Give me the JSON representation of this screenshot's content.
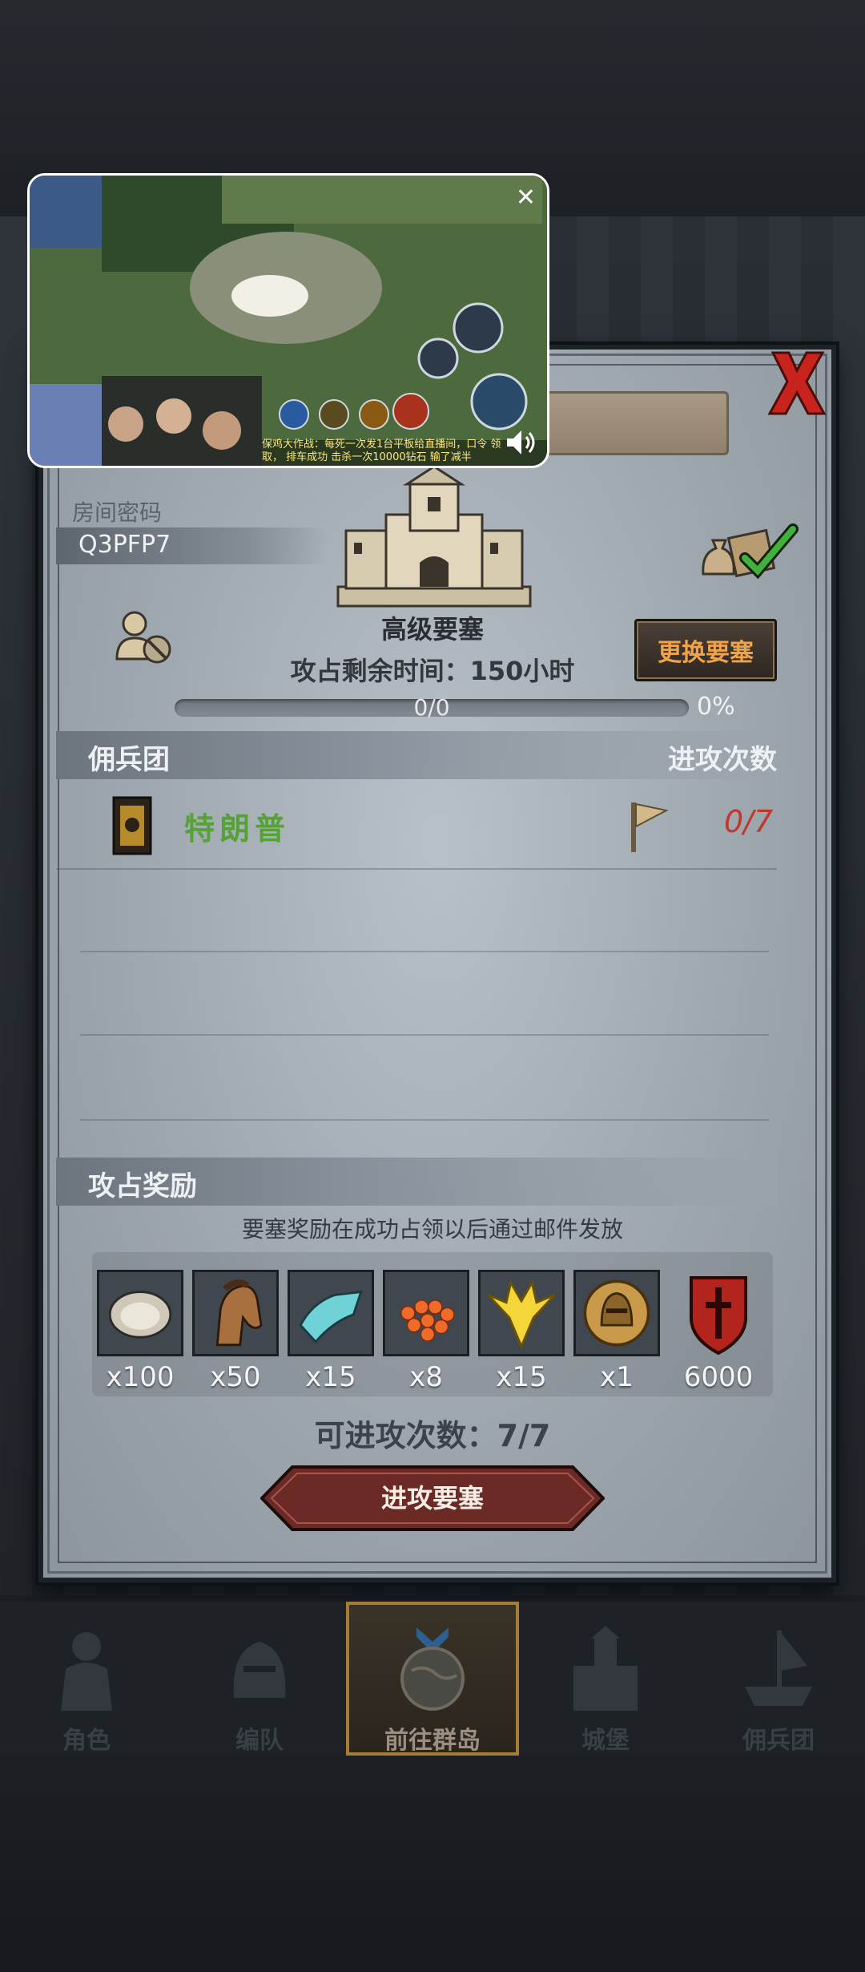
{
  "room": {
    "label": "房间密码",
    "code": "Q3PFP7"
  },
  "fortress": {
    "name": "高级要塞",
    "time_left": "攻占剩余时间：150小时",
    "change_button": "更换要塞"
  },
  "progress": {
    "text": "0/0",
    "percent_text": "0%",
    "fraction": 0
  },
  "mercenary_section": {
    "title": "佣兵团",
    "right_title": "进攻次数"
  },
  "mercenary": {
    "name": "特朗普",
    "attacks": "0/7"
  },
  "reward_section": {
    "title": "攻占奖励",
    "note": "要塞奖励在成功占领以后通过邮件发放"
  },
  "rewards": [
    {
      "icon": "oyster-icon",
      "qty": "x100"
    },
    {
      "icon": "horse-icon",
      "qty": "x50"
    },
    {
      "icon": "cloth-icon",
      "qty": "x15"
    },
    {
      "icon": "roe-icon",
      "qty": "x8"
    },
    {
      "icon": "gold-crest-icon",
      "qty": "x15"
    },
    {
      "icon": "helmet-coin-icon",
      "qty": "x1"
    },
    {
      "icon": "red-shield-icon",
      "qty": "6000"
    }
  ],
  "attacks_left": "可进攻次数：7/7",
  "attack_button": "进攻要塞",
  "nav": [
    {
      "label": "角色",
      "icon": "knight-icon",
      "active": false
    },
    {
      "label": "编队",
      "icon": "helmet-icon",
      "active": false
    },
    {
      "label": "前往群岛",
      "icon": "globe-icon",
      "active": true
    },
    {
      "label": "城堡",
      "icon": "castle-icon",
      "active": false
    },
    {
      "label": "佣兵团",
      "icon": "ship-icon",
      "active": false
    }
  ],
  "video": {
    "caption": "保鸡大作战：每死一次发1台平板给直播间，口令 领取，  排车成功 击杀一次10000钻石 输了减半",
    "close_symbol": "✕"
  },
  "colors": {
    "accent_orange": "#f1a348",
    "merc_green": "#55a236",
    "attack_red": "#c0382c"
  }
}
